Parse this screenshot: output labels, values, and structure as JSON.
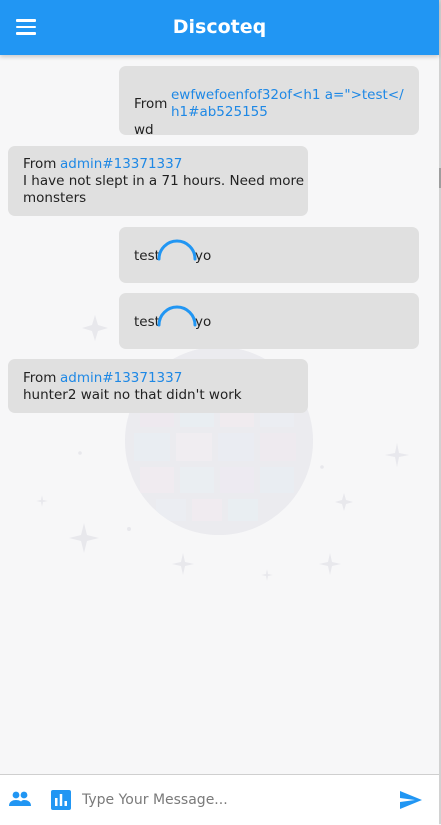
{
  "app": {
    "title": "Discoteq"
  },
  "colors": {
    "primary": "#2196f3",
    "bubble": "#e0e0e0",
    "link": "#1e88e5"
  },
  "messages": [
    {
      "from_label": "From",
      "sender_line1": "ewfwefoenfof32of<h1 a=\">test</",
      "sender_line2": "h1#ab525155",
      "text": "wd"
    },
    {
      "from_label": "From",
      "sender": "admin#13371337",
      "text_line1": "I have not slept in a 71 hours. Need more",
      "text_line2": "monsters"
    },
    {
      "text_before": "test",
      "text_after": "yo"
    },
    {
      "text_before": "test",
      "text_after": "yo"
    },
    {
      "from_label": "From",
      "sender": "admin#13371337",
      "text": "hunter2 wait no that didn't work"
    }
  ],
  "composer": {
    "placeholder": "Type Your Message..."
  },
  "icons": {
    "menu": "menu-icon",
    "people": "people-icon",
    "poll": "bar-chart-icon",
    "send": "send-icon"
  }
}
